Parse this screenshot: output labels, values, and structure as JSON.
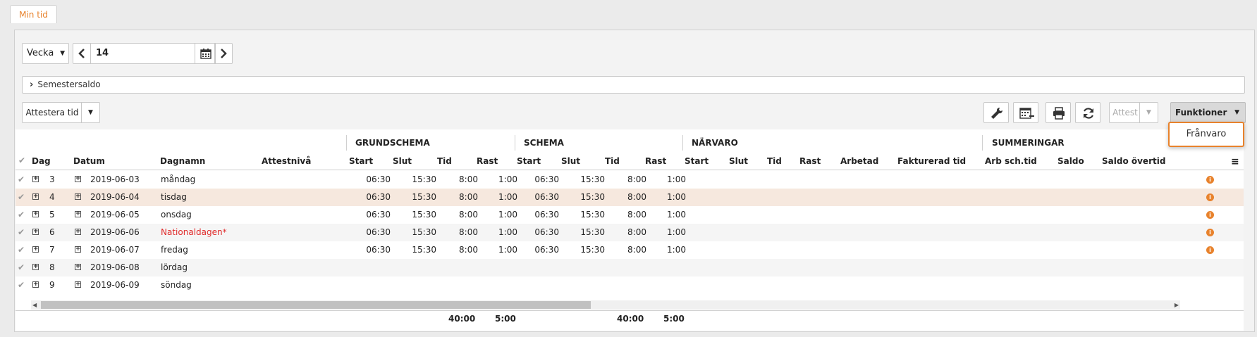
{
  "tab": {
    "label": "Min tid"
  },
  "period": {
    "type": "Vecka",
    "week": "14"
  },
  "saldo": {
    "label": "Semestersaldo"
  },
  "toolbar": {
    "attest_time_label": "Attestera tid",
    "attest_label": "Attest",
    "functions_label": "Funktioner",
    "menu_items": [
      "Frånvaro"
    ]
  },
  "groups": [
    "GRUNDSCHEMA",
    "SCHEMA",
    "NÄRVARO",
    "SUMMERINGAR"
  ],
  "columns": {
    "dag": "Dag",
    "datum": "Datum",
    "dagnamn": "Dagnamn",
    "attestniva": "Attestnivå",
    "start": "Start",
    "slut": "Slut",
    "tid": "Tid",
    "rast": "Rast",
    "arbetad": "Arbetad",
    "fakturerad": "Fakturerad tid",
    "arbsch": "Arb sch.tid",
    "saldo": "Saldo",
    "saldo_overtid": "Saldo övertid"
  },
  "rows": [
    {
      "dag": "3",
      "datum": "2019-06-03",
      "dagnamn": "måndag",
      "gs": [
        "06:30",
        "15:30",
        "8:00",
        "1:00"
      ],
      "s": [
        "06:30",
        "15:30",
        "8:00",
        "1:00"
      ],
      "info": true
    },
    {
      "dag": "4",
      "datum": "2019-06-04",
      "dagnamn": "tisdag",
      "gs": [
        "06:30",
        "15:30",
        "8:00",
        "1:00"
      ],
      "s": [
        "06:30",
        "15:30",
        "8:00",
        "1:00"
      ],
      "info": true
    },
    {
      "dag": "5",
      "datum": "2019-06-05",
      "dagnamn": "onsdag",
      "gs": [
        "06:30",
        "15:30",
        "8:00",
        "1:00"
      ],
      "s": [
        "06:30",
        "15:30",
        "8:00",
        "1:00"
      ],
      "info": true
    },
    {
      "dag": "6",
      "datum": "2019-06-06",
      "dagnamn": "Nationaldagen*",
      "gs": [
        "06:30",
        "15:30",
        "8:00",
        "1:00"
      ],
      "s": [
        "06:30",
        "15:30",
        "8:00",
        "1:00"
      ],
      "info": true
    },
    {
      "dag": "7",
      "datum": "2019-06-07",
      "dagnamn": "fredag",
      "gs": [
        "06:30",
        "15:30",
        "8:00",
        "1:00"
      ],
      "s": [
        "06:30",
        "15:30",
        "8:00",
        "1:00"
      ],
      "info": true
    },
    {
      "dag": "8",
      "datum": "2019-06-08",
      "dagnamn": "lördag",
      "gs": [
        "",
        "",
        "",
        ""
      ],
      "s": [
        "",
        "",
        "",
        ""
      ],
      "info": false
    },
    {
      "dag": "9",
      "datum": "2019-06-09",
      "dagnamn": "söndag",
      "gs": [
        "",
        "",
        "",
        ""
      ],
      "s": [
        "",
        "",
        "",
        ""
      ],
      "info": false
    }
  ],
  "totals": {
    "gs_tid": "40:00",
    "gs_rast": "5:00",
    "s_tid": "40:00",
    "s_rast": "5:00"
  },
  "colors": {
    "accent": "#e8822c",
    "holiday": "#e02b2b",
    "highlight": "#f6e8de"
  }
}
